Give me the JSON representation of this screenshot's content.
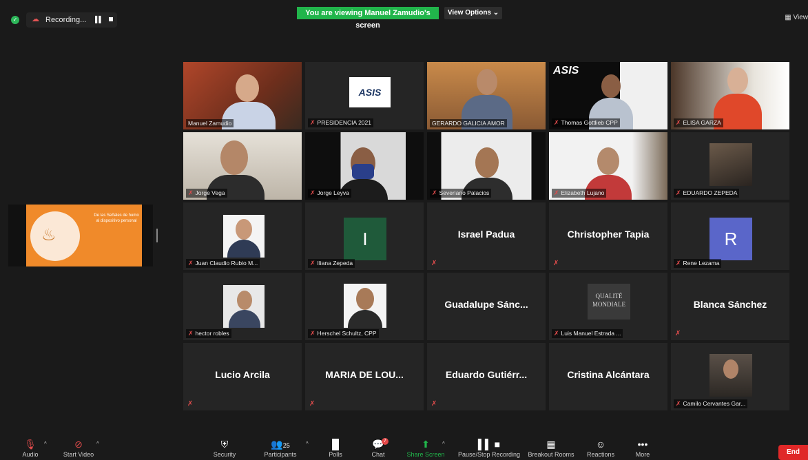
{
  "top": {
    "recording_label": "Recording...",
    "viewing_banner": "You are viewing Manuel Zamudio's screen",
    "view_options_label": "View Options ⌄",
    "view_label": "View"
  },
  "share": {
    "slide_text": "De las Señales de humo al dispositivo personal"
  },
  "tiles": [
    {
      "name": "Manuel Zamudio",
      "muted": false
    },
    {
      "name": "PRESIDENCIA 2021",
      "muted": true,
      "logo": "ASIS"
    },
    {
      "name": "GERARDO GALICIA AMOR",
      "muted": false
    },
    {
      "name": "Thomas Gottlieb CPP",
      "muted": true,
      "logo": "ASIS"
    },
    {
      "name": "ELISA GARZA",
      "muted": true
    },
    {
      "name": "Jorge Vega",
      "muted": true
    },
    {
      "name": "Jorge Leyva",
      "muted": true
    },
    {
      "name": "Severiano Palacios",
      "muted": true
    },
    {
      "name": "Elizabeth Lujano",
      "muted": true
    },
    {
      "name": "EDUARDO ZEPEDA",
      "muted": true
    },
    {
      "name": "Juan Claudio Rubio M...",
      "muted": true
    },
    {
      "name": "Iliana Zepeda",
      "muted": true,
      "avatar_letter": "I",
      "avatar_color": "#1f5a3a"
    },
    {
      "center_name": "Israel Padua",
      "muted": true
    },
    {
      "center_name": "Christopher Tapia",
      "muted": true
    },
    {
      "name": "Rene Lezama",
      "muted": true,
      "avatar_letter": "R",
      "avatar_color": "#5a66c9"
    },
    {
      "name": "hector robles",
      "muted": true
    },
    {
      "name": "Herschel Schultz, CPP",
      "muted": true
    },
    {
      "center_name": "Guadalupe Sánc...",
      "muted": false
    },
    {
      "name": "Luis Manuel Estrada ...",
      "muted": true,
      "logo": "QUALITÉ MONDIALE"
    },
    {
      "center_name": "Blanca Sánchez",
      "muted": true
    },
    {
      "center_name": "Lucio Arcila",
      "muted": true
    },
    {
      "center_name": "MARIA DE LOU...",
      "muted": true
    },
    {
      "center_name": "Eduardo Gutiérr...",
      "muted": true
    },
    {
      "center_name": "Cristina Alcántara",
      "muted": false
    },
    {
      "name": "Camilo Cervantes Gar...",
      "muted": true
    }
  ],
  "toolbar": {
    "audio": "Audio",
    "start_video": "Start Video",
    "security": "Security",
    "participants": "Participants",
    "participants_count": "25",
    "polls": "Polls",
    "chat": "Chat",
    "chat_badge": "7",
    "share_screen": "Share Screen",
    "pause_stop_recording": "Pause/Stop Recording",
    "breakout_rooms": "Breakout Rooms",
    "reactions": "Reactions",
    "more": "More",
    "end": "End"
  },
  "colors": {
    "banner_green": "#21b54b",
    "end_red": "#e02828",
    "mute_red": "#e14c4c",
    "active_speaker": "#d8e05a"
  }
}
